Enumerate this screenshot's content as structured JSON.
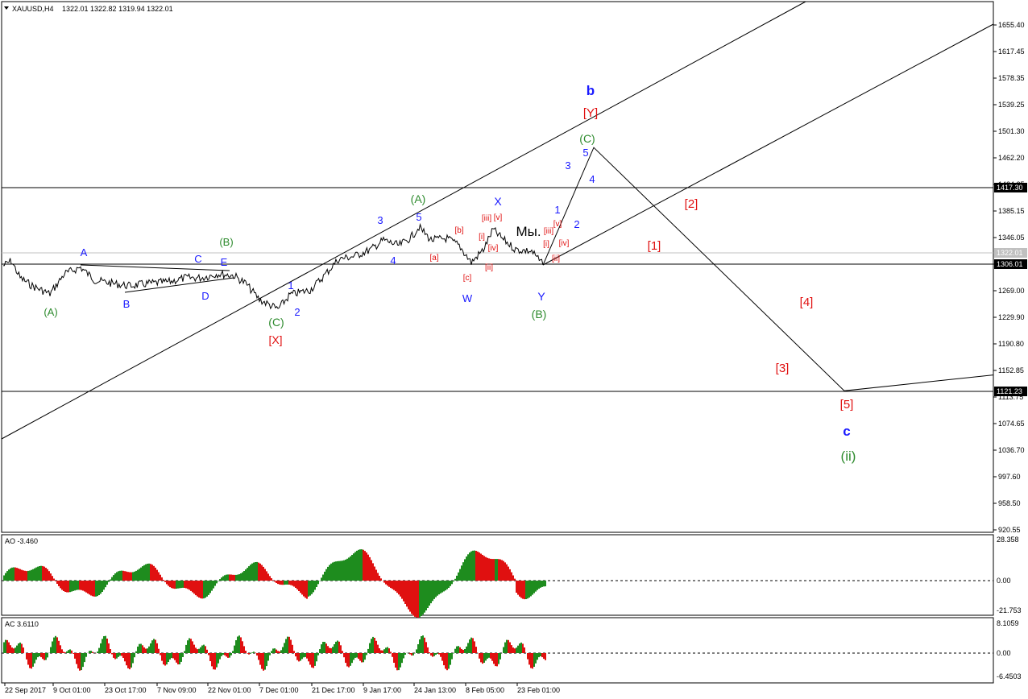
{
  "header": {
    "symbol": "XAUUSD,H4",
    "ohlc": "1322.01 1322.82 1319.94 1322.01"
  },
  "price_axis": {
    "ticks": [
      "1655.40",
      "1617.45",
      "1578.35",
      "1539.25",
      "1501.30",
      "1462.20",
      "1424.25",
      "1385.15",
      "1346.05",
      "1308.10",
      "1269.00",
      "1229.90",
      "1190.80",
      "1152.85",
      "1113.75",
      "1074.65",
      "1036.70",
      "997.60",
      "958.50",
      "920.55"
    ],
    "labels": [
      {
        "text": "1417.30",
        "price": 1417.3,
        "color": "#000000"
      },
      {
        "text": "1322.01",
        "price": 1322.01,
        "color": "#c0c0c0"
      },
      {
        "text": "1306.01",
        "price": 1306.01,
        "color": "#000000"
      },
      {
        "text": "1121.23",
        "price": 1121.23,
        "color": "#000000"
      }
    ]
  },
  "time_axis": {
    "labels": [
      "22 Sep 2017",
      "9 Oct 01:00",
      "23 Oct 17:00",
      "7 Nov 09:00",
      "22 Nov 01:00",
      "7 Dec 01:00",
      "21 Dec 17:00",
      "9 Jan 17:00",
      "24 Jan 13:00",
      "8 Feb 05:00",
      "23 Feb 01:00"
    ]
  },
  "ao_panel": {
    "title": "AO -3.460",
    "ticks": [
      "28.358",
      "0.00",
      "-21.753"
    ]
  },
  "ac_panel": {
    "title": "AC 3.6110",
    "ticks": [
      "8.1059",
      "0.00",
      "-6.4503"
    ]
  },
  "colors": {
    "green": "#2e8b2e",
    "blue": "#1a1aff",
    "red": "#e01010",
    "dark": "#000000"
  },
  "chart_data": {
    "type": "line",
    "title": "XAUUSD,H4",
    "price_range": [
      920.55,
      1674
    ],
    "horizontal_levels": [
      1417.3,
      1322.01,
      1306.01,
      1121.23
    ],
    "series": [
      {
        "x": [
          "22 Sep 2017",
          "9 Oct 01:00",
          "23 Oct 17:00",
          "7 Nov 09:00",
          "22 Nov 01:00",
          "7 Dec 01:00",
          "21 Dec 17:00",
          "9 Jan 17:00",
          "24 Jan 13:00",
          "8 Feb 05:00",
          "23 Feb 01:00"
        ],
        "values": [
          1296,
          1280,
          1281,
          1279,
          1292,
          1245,
          1290,
          1330,
          1352,
          1316,
          1316
        ]
      }
    ],
    "forecast_path": [
      {
        "x": "23 Feb 01:00",
        "y": 1306
      },
      {
        "x": "forecast",
        "y": 1477
      },
      {
        "x": "forecast",
        "y": 1123
      },
      {
        "x": "forecast",
        "y": 1146
      }
    ],
    "wave_labels": [
      {
        "text": "(A)",
        "color": "green"
      },
      {
        "text": "A",
        "color": "blue"
      },
      {
        "text": "B",
        "color": "blue"
      },
      {
        "text": "C",
        "color": "blue"
      },
      {
        "text": "D",
        "color": "blue"
      },
      {
        "text": "E",
        "color": "blue"
      },
      {
        "text": "(B)",
        "color": "green"
      },
      {
        "text": "(C)",
        "color": "green"
      },
      {
        "text": "[X]",
        "color": "red"
      },
      {
        "text": "1",
        "color": "blue"
      },
      {
        "text": "2",
        "color": "blue"
      },
      {
        "text": "3",
        "color": "blue"
      },
      {
        "text": "4",
        "color": "blue"
      },
      {
        "text": "5",
        "color": "blue"
      },
      {
        "text": "(A)",
        "color": "green"
      },
      {
        "text": "[a]",
        "color": "red"
      },
      {
        "text": "[b]",
        "color": "red"
      },
      {
        "text": "[c]",
        "color": "red"
      },
      {
        "text": "W",
        "color": "blue"
      },
      {
        "text": "[i]",
        "color": "red"
      },
      {
        "text": "[ii]",
        "color": "red"
      },
      {
        "text": "[iii]",
        "color": "red"
      },
      {
        "text": "[iv]",
        "color": "red"
      },
      {
        "text": "[v]",
        "color": "red"
      },
      {
        "text": "X",
        "color": "blue"
      },
      {
        "text": "Мы.",
        "color": "dark"
      },
      {
        "text": "[iii]",
        "color": "red"
      },
      {
        "text": "[v]",
        "color": "red"
      },
      {
        "text": "[i]",
        "color": "red"
      },
      {
        "text": "[iv]",
        "color": "red"
      },
      {
        "text": "[ii]",
        "color": "red"
      },
      {
        "text": "Y",
        "color": "blue"
      },
      {
        "text": "(B)",
        "color": "green"
      },
      {
        "text": "1",
        "color": "blue"
      },
      {
        "text": "2",
        "color": "blue"
      },
      {
        "text": "3",
        "color": "blue"
      },
      {
        "text": "4",
        "color": "blue"
      },
      {
        "text": "5",
        "color": "blue"
      },
      {
        "text": "(C)",
        "color": "green"
      },
      {
        "text": "[Y]",
        "color": "red"
      },
      {
        "text": "b",
        "color": "blue"
      },
      {
        "text": "[1]",
        "color": "red"
      },
      {
        "text": "[2]",
        "color": "red"
      },
      {
        "text": "[3]",
        "color": "red"
      },
      {
        "text": "[4]",
        "color": "red"
      },
      {
        "text": "[5]",
        "color": "red"
      },
      {
        "text": "c",
        "color": "blue"
      },
      {
        "text": "(ii)",
        "color": "green"
      }
    ]
  }
}
